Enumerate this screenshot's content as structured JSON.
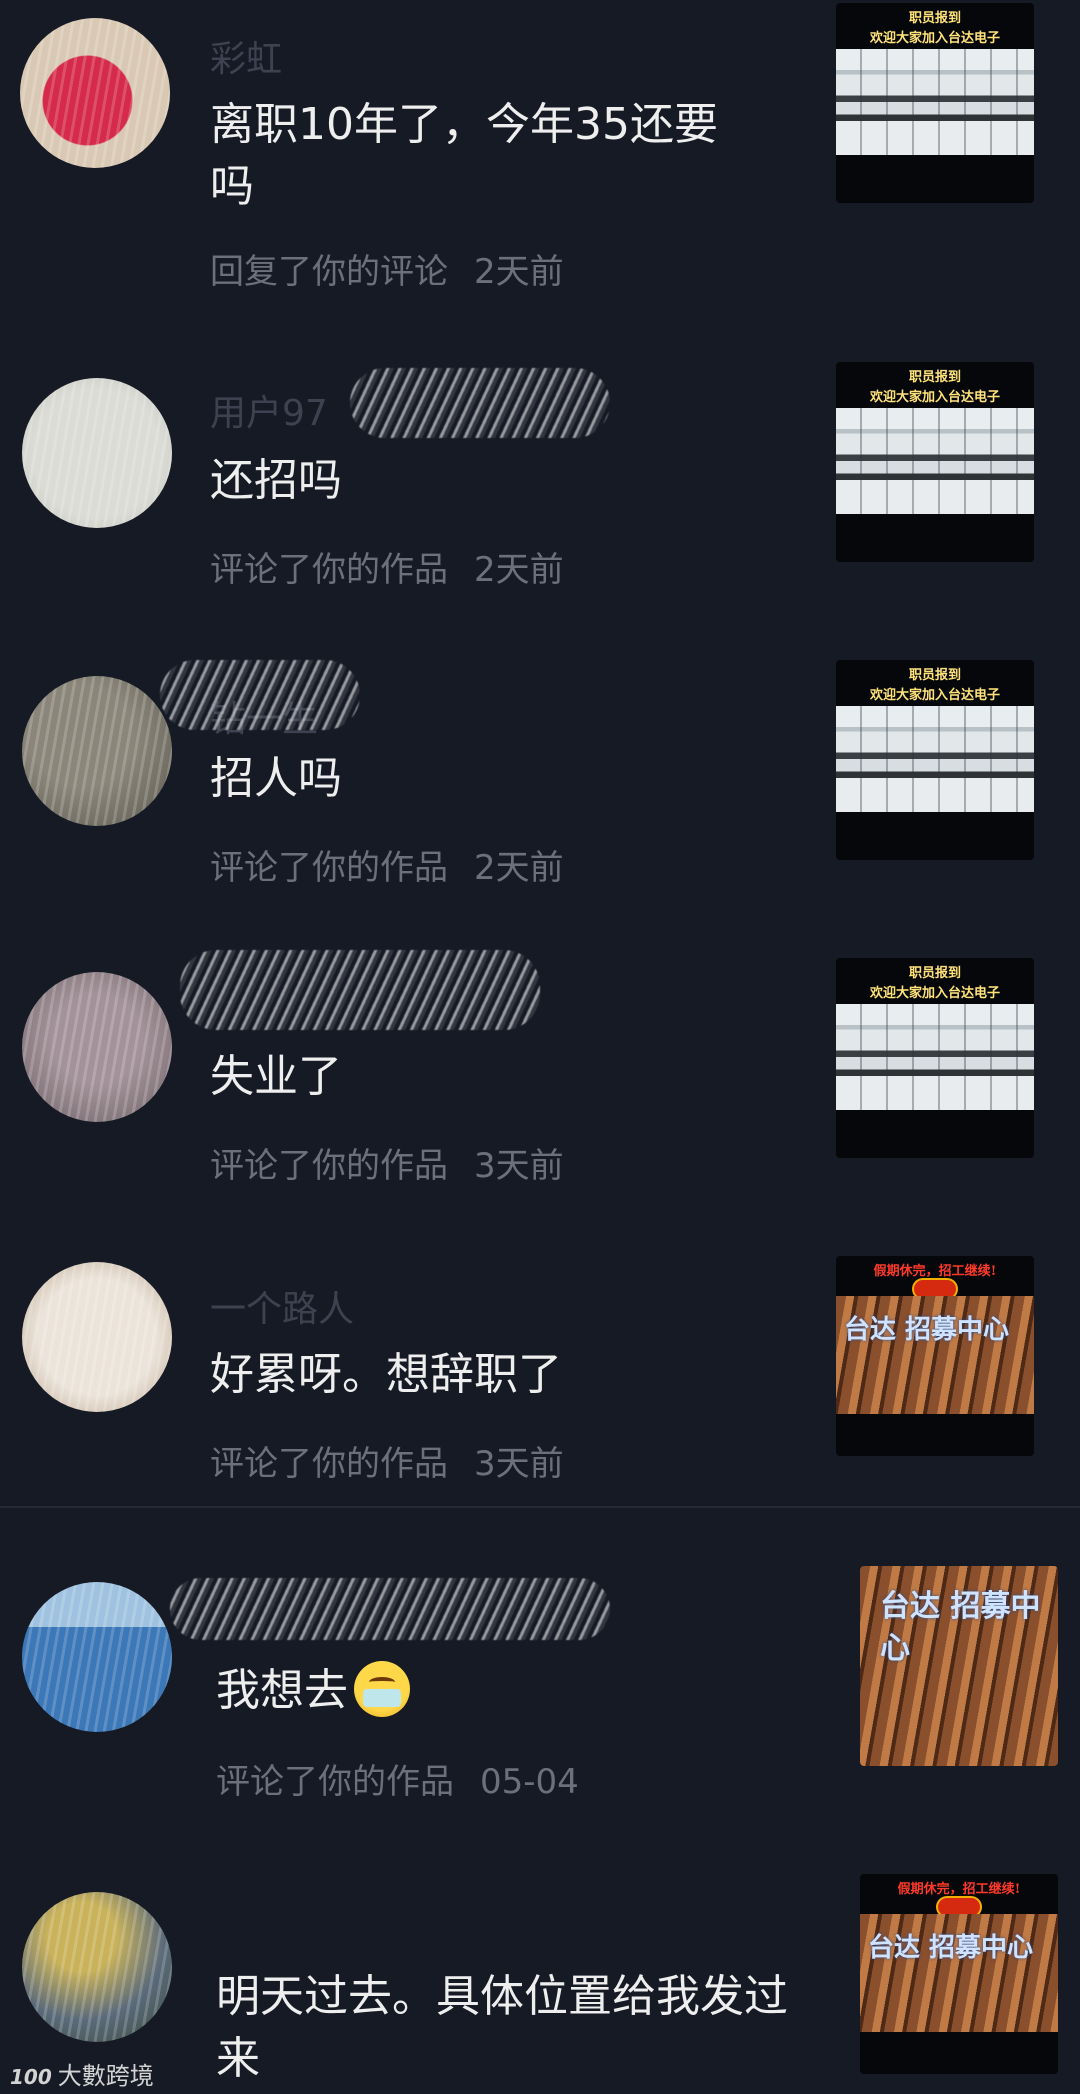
{
  "notifications": [
    {
      "username": "彩虹",
      "comment": "离职10年了，今年35还要吗",
      "action": "回复了你的评论",
      "time": "2天前",
      "thumb_caption_1": "职员报到",
      "thumb_caption_2": "欢迎大家加入台达电子",
      "avatar_color": "#d62a4a"
    },
    {
      "username": "用户97",
      "comment": "还招吗",
      "action": "评论了你的作品",
      "time": "2天前",
      "thumb_caption_1": "职员报到",
      "thumb_caption_2": "欢迎大家加入台达电子",
      "avatar_color": "#c9cbc6"
    },
    {
      "username": "钻一生",
      "comment": "招人吗",
      "action": "评论了你的作品",
      "time": "2天前",
      "thumb_caption_1": "职员报到",
      "thumb_caption_2": "欢迎大家加入台达电子",
      "avatar_color": "#6f6a5e"
    },
    {
      "username": "",
      "comment": "失业了",
      "action": "评论了你的作品",
      "time": "3天前",
      "thumb_caption_1": "职员报到",
      "thumb_caption_2": "欢迎大家加入台达电子",
      "avatar_color": "#7a6f74"
    },
    {
      "username": "一个路人",
      "comment": "好累呀。想辞职了",
      "action": "评论了你的作品",
      "time": "3天前",
      "thumb_caption_1": "假期休完，招工继续!",
      "thumb_sign": "台达 招募中心",
      "avatar_color": "#d8cfc4"
    },
    {
      "username": "",
      "comment": "我想去",
      "action": "评论了你的作品",
      "time": "05-04",
      "thumb_sign": "台达 招募中心",
      "avatar_color": "#4a86c8"
    },
    {
      "username": "",
      "comment": "明天过去。具体位置给我发过来",
      "action": "",
      "time": "",
      "thumb_caption_1": "假期休完，招工继续!",
      "thumb_sign": "台达 招募中心",
      "avatar_color": "#6e7a5a"
    }
  ],
  "emoji_name": "mask-face-emoji",
  "watermark": {
    "logo": "100",
    "text": "大數跨境"
  }
}
